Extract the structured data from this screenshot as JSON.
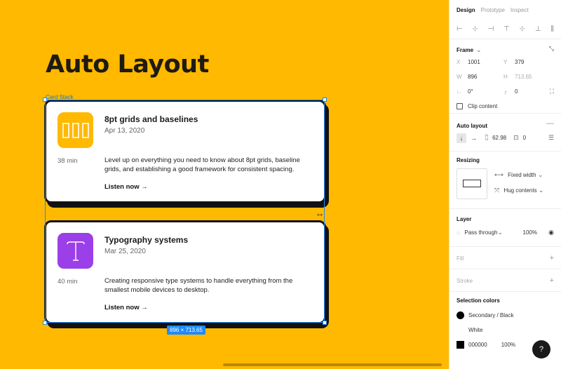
{
  "canvas": {
    "title": "Auto Layout",
    "frame_label": "Card Stack",
    "size_badge": "896 × 713.65"
  },
  "cards": [
    {
      "title": "8pt grids and baselines",
      "date": "Apr 13, 2020",
      "duration": "38 min",
      "description": "Level up on everything you need to know about 8pt grids, baseline grids, and establishing a good framework for consistent spacing.",
      "link": "Listen now →",
      "icon": "grid-columns-icon",
      "icon_color": "#FFB900"
    },
    {
      "title": "Typography systems",
      "date": "Mar 25, 2020",
      "duration": "40 min",
      "description": "Creating responsive type systems to handle everything from the smallest mobile devices to desktop.",
      "link": "Listen now →",
      "icon": "type-t-icon",
      "icon_color": "#9B3FE8"
    }
  ],
  "panel": {
    "tabs": [
      "Design",
      "Prototype",
      "Inspect"
    ],
    "frame": {
      "heading": "Frame",
      "x_label": "X",
      "x": "1001",
      "y_label": "Y",
      "y": "379",
      "w_label": "W",
      "w": "896",
      "h_label": "H",
      "h": "713.65",
      "rotation": "0°",
      "radius": "0",
      "clip_content": "Clip content"
    },
    "auto_layout": {
      "heading": "Auto layout",
      "spacing": "62.98",
      "padding": "0"
    },
    "resizing": {
      "heading": "Resizing",
      "horizontal": "Fixed width",
      "vertical": "Hug contents"
    },
    "layer": {
      "heading": "Layer",
      "blend": "Pass through",
      "opacity": "100%"
    },
    "fill": {
      "heading": "Fill"
    },
    "stroke": {
      "heading": "Stroke"
    },
    "selection_colors": {
      "heading": "Selection colors",
      "colors": [
        {
          "name": "Secondary / Black",
          "swatch": "#000000"
        },
        {
          "name": "White",
          "swatch": "#FFFFFF"
        },
        {
          "name": "000000",
          "opacity": "100%",
          "swatch": "#000000"
        }
      ]
    },
    "help": "?"
  }
}
